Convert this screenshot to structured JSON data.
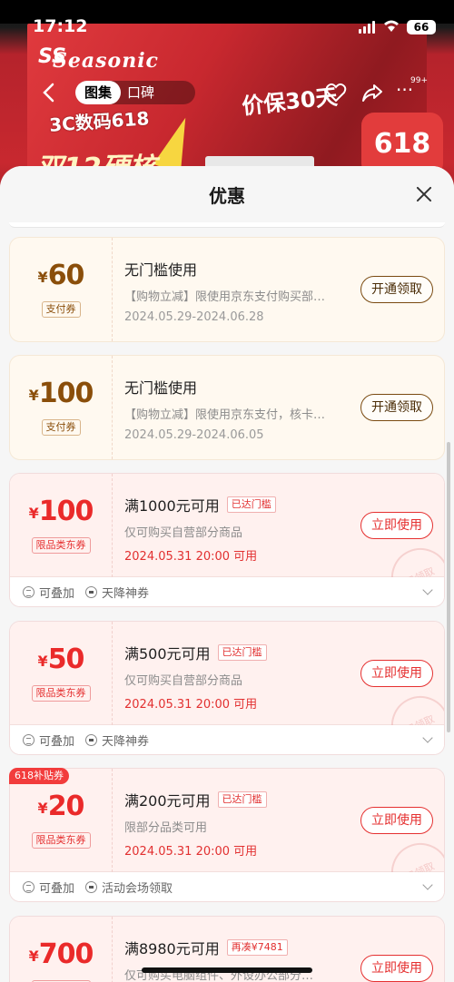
{
  "status_bar": {
    "time": "17:12",
    "battery": "66"
  },
  "background": {
    "brand": "Seasonic",
    "brand_mark": "SS",
    "promo": "3C数码618",
    "price_guarantee": "价保30天",
    "badge_618": "618",
    "big_text": "双12硬核",
    "tabs": {
      "gallery": "图集",
      "review": "口碑"
    },
    "more_badge": "99+"
  },
  "sheet": {
    "title": "优惠",
    "coupons": [
      {
        "style": "pay",
        "yen": "¥",
        "amount": "60",
        "type": "支付券",
        "title": "无门槛使用",
        "desc": "【购物立减】限使用京东支付购买部…",
        "date": "2024.05.29-2024.06.28",
        "button": "开通领取"
      },
      {
        "style": "pay",
        "yen": "¥",
        "amount": "100",
        "type": "支付券",
        "title": "无门槛使用",
        "desc": "【购物立减】限使用京东支付，核卡…",
        "date": "2024.05.29-2024.06.05",
        "button": "开通领取"
      },
      {
        "style": "red",
        "yen": "¥",
        "amount": "100",
        "type": "限品类东券",
        "title": "满1000元可用",
        "tag": "已达门槛",
        "desc": "仅可购买自营部分商品",
        "date": "2024.05.31 20:00 可用",
        "button": "立即使用",
        "stamp": "已领取",
        "foot": [
          "可叠加",
          "天降神券"
        ]
      },
      {
        "style": "red",
        "yen": "¥",
        "amount": "50",
        "type": "限品类东券",
        "title": "满500元可用",
        "tag": "已达门槛",
        "desc": "仅可购买自营部分商品",
        "date": "2024.05.31 20:00 可用",
        "button": "立即使用",
        "stamp": "已领取",
        "foot": [
          "可叠加",
          "天降神券"
        ]
      },
      {
        "style": "red",
        "badge": "618补贴券",
        "yen": "¥",
        "amount": "20",
        "type": "限品类东券",
        "title": "满200元可用",
        "tag": "已达门槛",
        "desc": "限部分品类可用",
        "date": "2024.05.31 20:00 可用",
        "button": "立即使用",
        "stamp": "已领取",
        "foot": [
          "可叠加",
          "活动会场领取"
        ]
      },
      {
        "style": "red",
        "yen": "¥",
        "amount": "700",
        "type": "限品类东券",
        "title": "满8980元可用",
        "tag": "再凑¥7481",
        "desc": "仅可购买电脑组件、外设办公部分…",
        "date": "",
        "button": "立即使用"
      }
    ]
  },
  "colors": {
    "accent_red": "#e53030",
    "pay_brown": "#8a4e0a"
  },
  "icons": [
    "back-icon",
    "heart-icon",
    "share-icon",
    "more-icon",
    "close-icon",
    "stack-icon",
    "gift-icon",
    "chevron-down-icon"
  ]
}
